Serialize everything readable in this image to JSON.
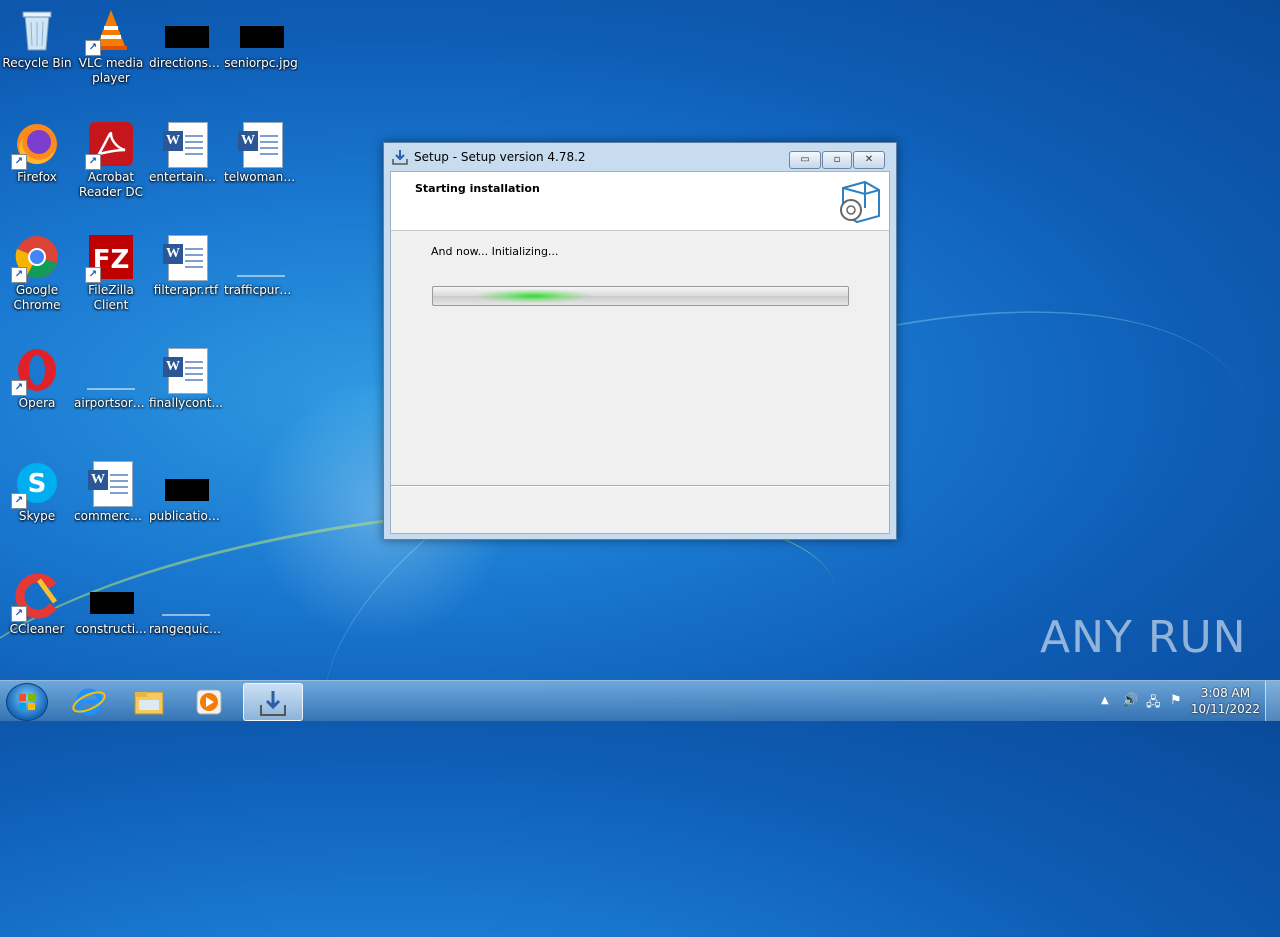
{
  "desktop": {
    "icons": [
      {
        "id": "recycle-bin",
        "label": "Recycle Bin"
      },
      {
        "id": "vlc",
        "label": "VLC media player"
      },
      {
        "id": "directions",
        "label": "directionsli..."
      },
      {
        "id": "seniorpc",
        "label": "seniorpc.jpg"
      },
      {
        "id": "firefox",
        "label": "Firefox"
      },
      {
        "id": "acrobat",
        "label": "Acrobat Reader DC"
      },
      {
        "id": "entertainm",
        "label": "entertainm..."
      },
      {
        "id": "telwoman",
        "label": "telwoman.rtf"
      },
      {
        "id": "chrome",
        "label": "Google Chrome"
      },
      {
        "id": "filezilla",
        "label": "FileZilla Client"
      },
      {
        "id": "filterapr",
        "label": "filterapr.rtf"
      },
      {
        "id": "trafficpurp",
        "label": "trafficpurp..."
      },
      {
        "id": "opera",
        "label": "Opera"
      },
      {
        "id": "airportsort",
        "label": "airportsort..."
      },
      {
        "id": "finallycont",
        "label": "finallycont..."
      },
      {
        "id": "skype",
        "label": "Skype"
      },
      {
        "id": "commerce",
        "label": "commerce..."
      },
      {
        "id": "publication",
        "label": "publication..."
      },
      {
        "id": "ccleaner",
        "label": "CCleaner"
      },
      {
        "id": "constructi",
        "label": "constructi..."
      },
      {
        "id": "rangequick",
        "label": "rangequick..."
      }
    ]
  },
  "window": {
    "title": "Setup - Setup version 4.78.2",
    "header_title": "Starting installation",
    "status_text": "And now... Initializing...",
    "progress_state": "indeterminate",
    "buttons": {
      "minimize": "▭",
      "restore": "▫",
      "close": "✕"
    }
  },
  "taskbar": {
    "clock_time": "3:08 AM",
    "clock_date": "10/11/2022"
  },
  "watermark": "ANY RUN",
  "colors": {
    "accent_green": "#2fdc2f",
    "desktop_blue": "#1a78d0"
  }
}
